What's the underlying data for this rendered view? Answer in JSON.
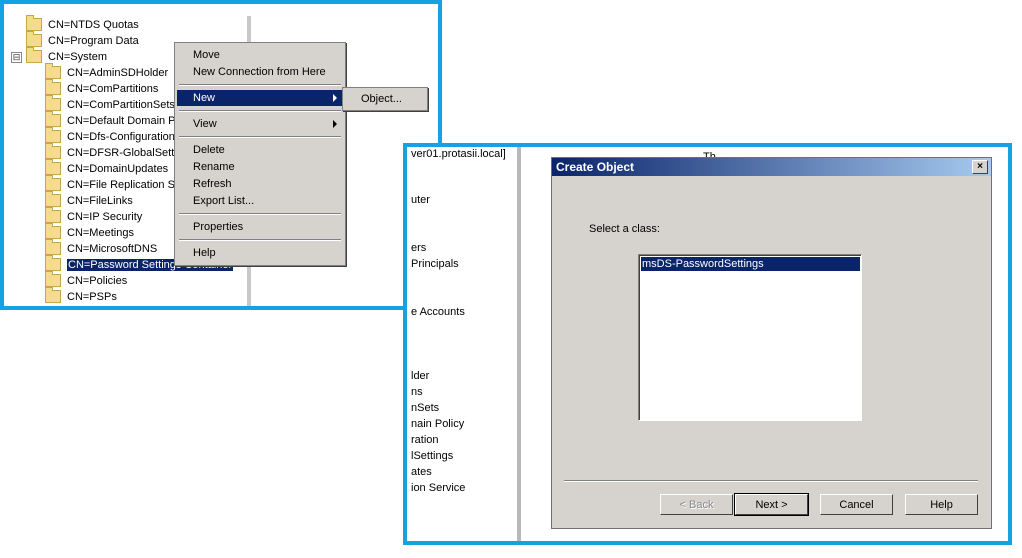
{
  "tree": {
    "items": [
      {
        "label": "CN=NTDS Quotas"
      },
      {
        "label": "CN=Program Data"
      },
      {
        "label": "CN=System",
        "expander": "⊟"
      },
      {
        "label": "CN=AdminSDHolder"
      },
      {
        "label": "CN=ComPartitions"
      },
      {
        "label": "CN=ComPartitionSets"
      },
      {
        "label": "CN=Default Domain P"
      },
      {
        "label": "CN=Dfs-Configuration"
      },
      {
        "label": "CN=DFSR-GlobalSetti"
      },
      {
        "label": "CN=DomainUpdates"
      },
      {
        "label": "CN=File Replication Se"
      },
      {
        "label": "CN=FileLinks"
      },
      {
        "label": "CN=IP Security"
      },
      {
        "label": "CN=Meetings"
      },
      {
        "label": "CN=MicrosoftDNS"
      },
      {
        "label": "CN=Password Settings Container"
      },
      {
        "label": "CN=Policies"
      },
      {
        "label": "CN=PSPs"
      }
    ]
  },
  "context_menu": {
    "items": [
      {
        "label": "Move"
      },
      {
        "label": "New Connection from Here"
      },
      {
        "label": "New"
      },
      {
        "label": "View"
      },
      {
        "label": "Delete"
      },
      {
        "label": "Rename"
      },
      {
        "label": "Refresh"
      },
      {
        "label": "Export List..."
      },
      {
        "label": "Properties"
      },
      {
        "label": "Help"
      }
    ]
  },
  "submenu": {
    "items": [
      {
        "label": "Object..."
      }
    ]
  },
  "background_tree": {
    "items": [
      "ver01.protasii.local]",
      "Th",
      "uter",
      "ers",
      "Principals",
      "e Accounts",
      "lder",
      "ns",
      "nSets",
      "nain Policy",
      "ration",
      "lSettings",
      "ates",
      "ion Service"
    ]
  },
  "dialog": {
    "title": "Create Object",
    "close_glyph": "×",
    "select_label": "Select a class:",
    "classes": [
      "msDS-PasswordSettings"
    ],
    "buttons": {
      "back": "< Back",
      "next": "Next >",
      "cancel": "Cancel",
      "help": "Help"
    }
  },
  "colors": {
    "highlight_border": "#16a2e2",
    "selection": "#0a246a",
    "dialog_face": "#d6d3ce"
  }
}
